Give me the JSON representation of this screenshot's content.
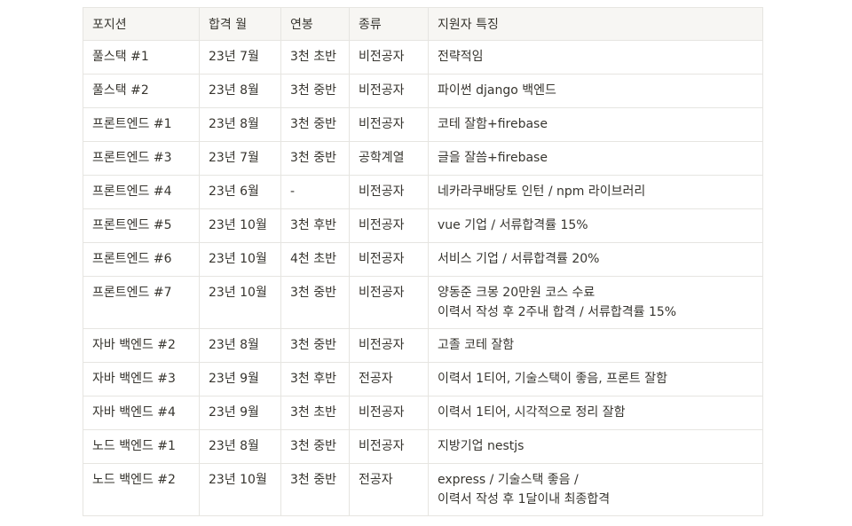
{
  "table": {
    "headers": [
      "포지션",
      "합격 월",
      "연봉",
      "종류",
      "지원자 특징"
    ],
    "rows": [
      {
        "position": "풀스택 #1",
        "month": "23년 7월",
        "salary": "3천 초반",
        "type": "비전공자",
        "features": [
          "전략적임"
        ]
      },
      {
        "position": "풀스택 #2",
        "month": "23년 8월",
        "salary": "3천 중반",
        "type": "비전공자",
        "features": [
          "파이썬 django 백엔드"
        ]
      },
      {
        "position": "프론트엔드 #1",
        "month": "23년 8월",
        "salary": "3천 중반",
        "type": "비전공자",
        "features": [
          "코테 잘함+firebase"
        ]
      },
      {
        "position": "프론트엔드 #3",
        "month": "23년 7월",
        "salary": "3천 중반",
        "type": "공학계열",
        "features": [
          "글을 잘씀+firebase"
        ]
      },
      {
        "position": "프론트엔드 #4",
        "month": "23년 6월",
        "salary": "-",
        "type": "비전공자",
        "features": [
          "네카라쿠배당토 인턴 / npm 라이브러리"
        ]
      },
      {
        "position": "프론트엔드 #5",
        "month": "23년 10월",
        "salary": "3천 후반",
        "type": "비전공자",
        "features": [
          "vue 기업 / 서류합격률 15%"
        ]
      },
      {
        "position": "프론트엔드 #6",
        "month": "23년 10월",
        "salary": "4천 초반",
        "type": "비전공자",
        "features": [
          "서비스 기업 / 서류합격률 20%"
        ]
      },
      {
        "position": "프론트엔드 #7",
        "month": "23년 10월",
        "salary": "3천 중반",
        "type": "비전공자",
        "features": [
          "양동준 크몽 20만원 코스 수료",
          "이력서 작성 후 2주내 합격 / 서류합격률 15%"
        ]
      },
      {
        "position": "자바 백엔드 #2",
        "month": "23년 8월",
        "salary": "3천 중반",
        "type": "비전공자",
        "features": [
          "고졸 코테 잘함"
        ]
      },
      {
        "position": "자바 백엔드 #3",
        "month": "23년 9월",
        "salary": "3천 후반",
        "type": "전공자",
        "features": [
          "이력서 1티어, 기술스택이 좋음, 프론트 잘함"
        ]
      },
      {
        "position": "자바 백엔드 #4",
        "month": "23년 9월",
        "salary": "3천 초반",
        "type": "비전공자",
        "features": [
          "이력서 1티어, 시각적으로 정리 잘함"
        ]
      },
      {
        "position": "노드 백엔드 #1",
        "month": "23년 8월",
        "salary": "3천 중반",
        "type": "비전공자",
        "features": [
          "지방기업 nestjs"
        ]
      },
      {
        "position": "노드 백엔드 #2",
        "month": "23년 10월",
        "salary": "3천 중반",
        "type": "전공자",
        "features": [
          "express / 기술스택 좋음 /",
          "이력서 작성 후 1달이내 최종합격"
        ]
      }
    ]
  }
}
